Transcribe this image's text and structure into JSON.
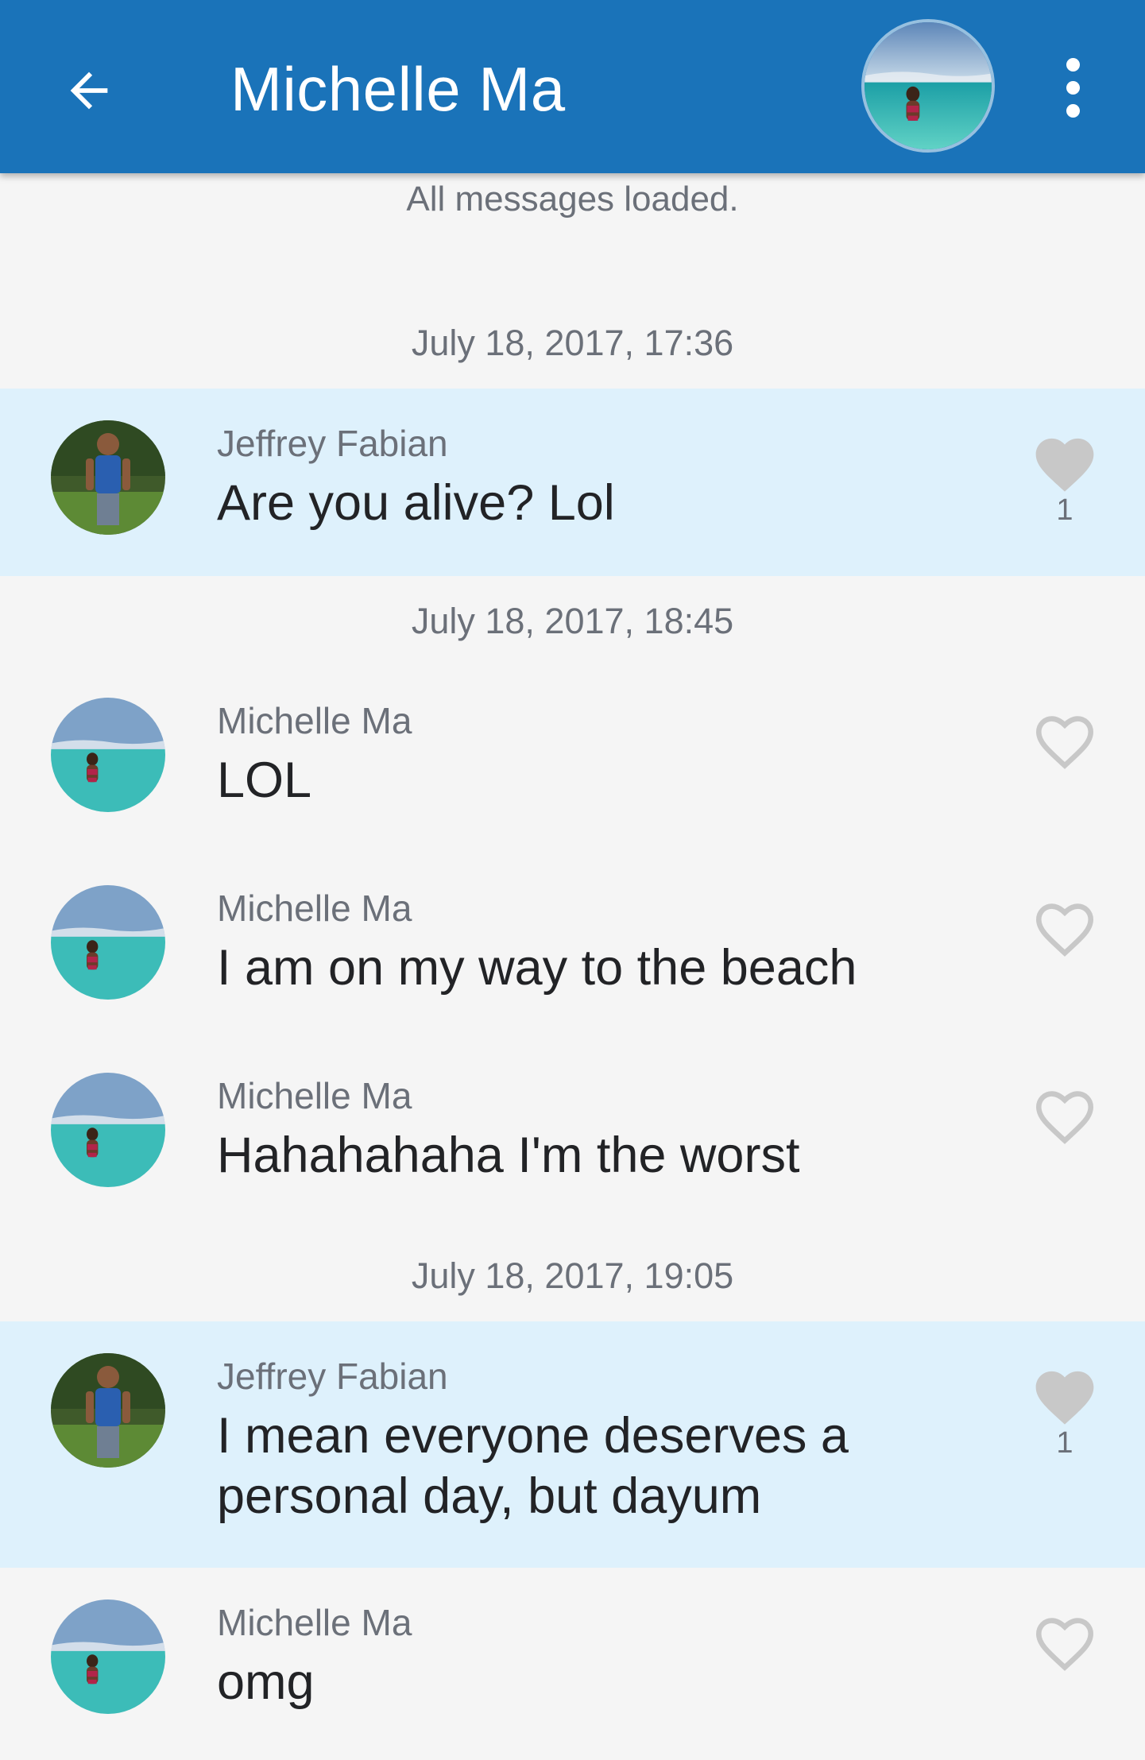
{
  "header": {
    "title": "Michelle Ma",
    "back_icon": "arrow-left-icon",
    "menu_icon": "more-vert-icon",
    "color": "#1a73b9"
  },
  "status": "All messages loaded.",
  "dates": [
    "July 18, 2017, 17:36",
    "July 18, 2017, 18:45",
    "July 18, 2017, 19:05"
  ],
  "messages": [
    {
      "sender": "Jeffrey Fabian",
      "text": "Are you alive? Lol",
      "liked": true,
      "likes": "1",
      "highlighted": true
    },
    {
      "sender": "Michelle Ma",
      "text": "LOL",
      "liked": false,
      "likes": "",
      "highlighted": false
    },
    {
      "sender": "Michelle Ma",
      "text": "I am on my way to the beach",
      "liked": false,
      "likes": "",
      "highlighted": false
    },
    {
      "sender": "Michelle Ma",
      "text": "Hahahahaha I'm the worst",
      "liked": false,
      "likes": "",
      "highlighted": false
    },
    {
      "sender": "Jeffrey Fabian",
      "text": "I mean everyone deserves a personal day, but dayum",
      "liked": true,
      "likes": "1",
      "highlighted": true
    },
    {
      "sender": "Michelle Ma",
      "text": "omg",
      "liked": false,
      "likes": "",
      "highlighted": false
    }
  ],
  "colors": {
    "highlight_row": "#def1fc",
    "heart_filled": "#c8c8c8",
    "secondary_text": "#6b7079"
  }
}
